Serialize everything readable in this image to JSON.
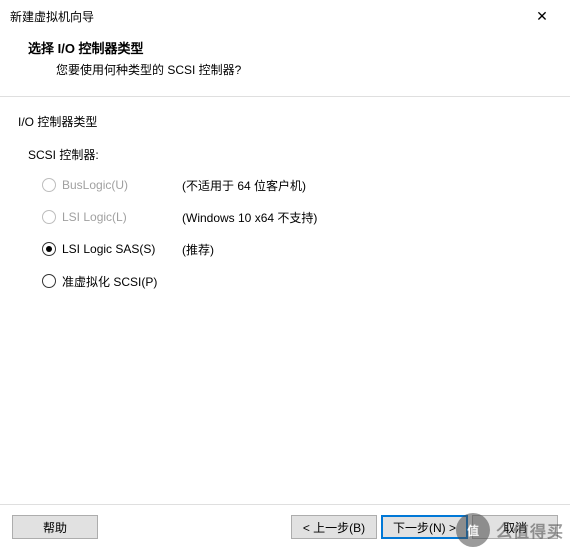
{
  "window": {
    "title": "新建虚拟机向导",
    "close_glyph": "✕"
  },
  "header": {
    "heading": "选择 I/O 控制器类型",
    "subheading": "您要使用何种类型的 SCSI 控制器?"
  },
  "group": {
    "title": "I/O 控制器类型",
    "sub_label": "SCSI 控制器:",
    "options": [
      {
        "label": "BusLogic(U)",
        "note": "(不适用于 64 位客户机)",
        "enabled": false,
        "selected": false
      },
      {
        "label": "LSI Logic(L)",
        "note": "(Windows 10 x64 不支持)",
        "enabled": false,
        "selected": false
      },
      {
        "label": "LSI Logic SAS(S)",
        "note": "(推荐)",
        "enabled": true,
        "selected": true
      },
      {
        "label": "准虚拟化 SCSI(P)",
        "note": "",
        "enabled": true,
        "selected": false
      }
    ]
  },
  "footer": {
    "help": "帮助",
    "back": "< 上一步(B)",
    "next": "下一步(N) >",
    "cancel": "取消"
  },
  "watermark": {
    "badge": "值",
    "text": "么值得买"
  }
}
